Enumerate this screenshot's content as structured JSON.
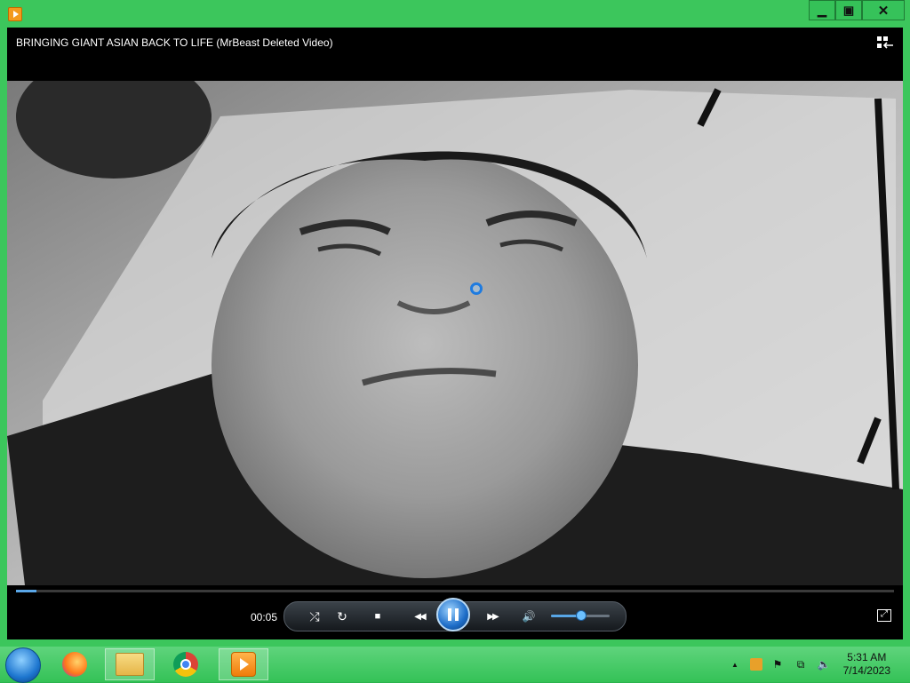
{
  "window": {
    "app_icon": "media-player-icon",
    "controls": {
      "minimize": "▁",
      "maximize": "▣",
      "close": "✕"
    }
  },
  "player": {
    "title": "BRINGING GIANT ASIAN BACK TO LIFE (MrBeast Deleted Video)",
    "switch_icon": "switch-to-library-icon",
    "video_description": "grayscale video frame",
    "progress_fraction": 0.023,
    "time": "00:05",
    "volume_fraction": 0.55
  },
  "controls": {
    "shuffle": "⤮",
    "repeat": "↻",
    "stop": "■",
    "previous": "◀◀",
    "next": "▶▶",
    "volume": "🔊",
    "fullscreen": "⤢"
  },
  "taskbar": {
    "items": [
      "start-button",
      "firefox",
      "file-explorer",
      "chrome",
      "windows-media-player"
    ],
    "tray": {
      "chevron": "▲",
      "flag": "⚑",
      "network": "⧉",
      "volume": "🔈"
    },
    "clock": {
      "time": "5:31 AM",
      "date": "7/14/2023"
    }
  },
  "colors": {
    "window_frame": "#3cc65c",
    "accent": "#1e7be0"
  }
}
